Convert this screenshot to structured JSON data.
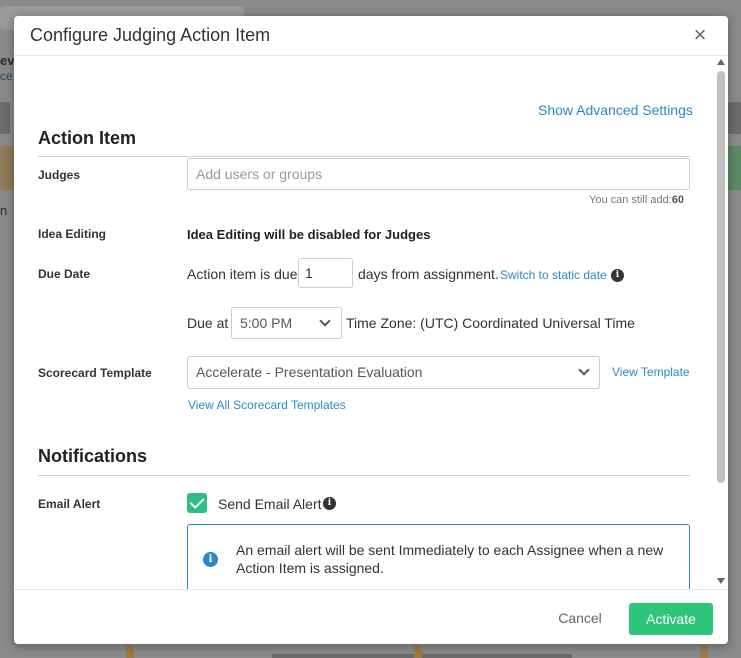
{
  "background": {
    "fragment_1": "ev",
    "fragment_2": "ce",
    "fragment_3": "n"
  },
  "modal": {
    "title": "Configure Judging Action Item",
    "close_icon": "×",
    "advanced_link": "Show Advanced Settings",
    "action_item_heading": "Action Item",
    "judges": {
      "label": "Judges",
      "placeholder": "Add users or groups",
      "hint_prefix": "You can still add:",
      "hint_count": "60"
    },
    "idea_editing": {
      "label": "Idea Editing",
      "value": "Idea Editing will be disabled for Judges"
    },
    "due_date": {
      "label": "Due Date",
      "prefix": "Action item is due",
      "days_value": "1",
      "suffix": "days from assignment.",
      "switch_link": "Switch to static date",
      "due_at_label": "Due at",
      "time_value": "5:00 PM",
      "timezone": "Time Zone: (UTC) Coordinated Universal Time"
    },
    "scorecard": {
      "label": "Scorecard Template",
      "selected": "Accelerate - Presentation Evaluation",
      "view_template_link": "View Template",
      "view_all_link": "View All Scorecard Templates"
    },
    "notifications_heading": "Notifications",
    "email_alert": {
      "label": "Email Alert",
      "checkbox_label": "Send Email Alert",
      "checked": true,
      "alert_text": "An email alert will be sent Immediately to each Assignee when a new Action Item is assigned."
    },
    "footer": {
      "cancel_label": "Cancel",
      "activate_label": "Activate"
    }
  },
  "colors": {
    "link": "#2a8bc4",
    "primary_button": "#2dc57a",
    "checkbox": "#2ebd85",
    "alert_border": "#2a8bc4"
  }
}
